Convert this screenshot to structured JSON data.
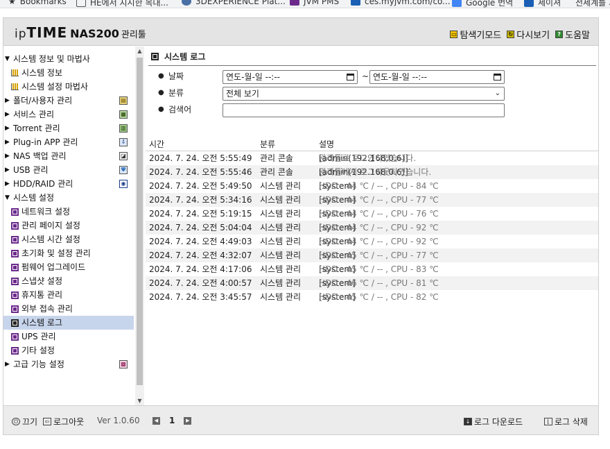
{
  "bookmarks": [
    {
      "label": "Bookmarks",
      "color": "#333333"
    },
    {
      "label": "HE에서 지시한 목대...",
      "color": "#555555"
    },
    {
      "label": "3DEXPERIENCE Plat...",
      "color": "#4a6fa5"
    },
    {
      "label": "JVM PMS",
      "color": "#6b2a8b"
    },
    {
      "label": "ces.myjvm.com/co...",
      "color": "#1a5fb4"
    },
    {
      "label": "Google 번역",
      "color": "#4285f4"
    },
    {
      "label": "세이셔",
      "color": "#1a5fb4"
    },
    {
      "label": "전세계를 가...",
      "color": "#777777"
    }
  ],
  "header": {
    "logo_ip": "ip",
    "logo_time": "TIME",
    "logo_model": "NAS200",
    "logo_suffix": "관리툴",
    "links": {
      "navigator": "탐색기모드",
      "reload": "다시보기",
      "help": "도움말"
    }
  },
  "sidebar": {
    "system_info": "시스템 정보 및 마법사",
    "system_info_item": "시스템 정보",
    "wizard": "시스템 설정 마법사",
    "folder_user": "폴더/사용자 관리",
    "service": "서비스 관리",
    "torrent": "Torrent 관리",
    "plugin": "Plug-in APP 관리",
    "nas_backup": "NAS 백업 관리",
    "usb": "USB 관리",
    "hdd_raid": "HDD/RAID 관리",
    "system_settings": "시스템 설정",
    "network": "네트워크 설정",
    "admin_page": "관리 페이지 설정",
    "system_time": "시스템 시간 설정",
    "reset": "초기화 및 설정 관리",
    "firmware": "펌웨어 업그레이드",
    "snapshot": "스냅샷 설정",
    "trash": "휴지통 관리",
    "remote_access": "외부 접속 관리",
    "system_log": "시스템 로그",
    "ups": "UPS 관리",
    "other": "기타 설정",
    "advanced": "고급 기능 설정"
  },
  "main": {
    "title": "시스템 로그",
    "filters": {
      "date_label": "날짜",
      "date_from": "연도-월-일  --:--",
      "date_sep": "~",
      "date_to": "연도-월-일  --:--",
      "category_label": "분류",
      "category_value": "전체 보기",
      "search_label": "검색어",
      "search_value": ""
    },
    "columns": {
      "time": "시간",
      "category": "분류",
      "description": "설명"
    },
    "rows": [
      {
        "time": "2024. 7. 24. 오전 5:55:49",
        "category": "관리 콘솔",
        "tag": "[admin(192.168.0.6)]",
        "message": " 관리툴로 로그인하였습니다."
      },
      {
        "time": "2024. 7. 24. 오전 5:55:46",
        "category": "관리 콘솔",
        "tag": "[admin(192.168.0.6)]",
        "message": " 관리툴에서 로그아웃하였습니다."
      },
      {
        "time": "2024. 7. 24. 오전 5:49:50",
        "category": "시스템 관리",
        "tag": "[system]",
        "message": " HDD - 44 ℃ / -- , CPU - 84 ℃"
      },
      {
        "time": "2024. 7. 24. 오전 5:34:16",
        "category": "시스템 관리",
        "tag": "[system]",
        "message": " HDD - 44 ℃ / -- , CPU - 77 ℃"
      },
      {
        "time": "2024. 7. 24. 오전 5:19:15",
        "category": "시스템 관리",
        "tag": "[system]",
        "message": " HDD - 44 ℃ / -- , CPU - 76 ℃"
      },
      {
        "time": "2024. 7. 24. 오전 5:04:04",
        "category": "시스템 관리",
        "tag": "[system]",
        "message": " HDD - 44 ℃ / -- , CPU - 92 ℃"
      },
      {
        "time": "2024. 7. 24. 오전 4:49:03",
        "category": "시스템 관리",
        "tag": "[system]",
        "message": " HDD - 44 ℃ / -- , CPU - 92 ℃"
      },
      {
        "time": "2024. 7. 24. 오전 4:32:07",
        "category": "시스템 관리",
        "tag": "[system]",
        "message": " HDD - 45 ℃ / -- , CPU - 77 ℃"
      },
      {
        "time": "2024. 7. 24. 오전 4:17:06",
        "category": "시스템 관리",
        "tag": "[system]",
        "message": " HDD - 45 ℃ / -- , CPU - 83 ℃"
      },
      {
        "time": "2024. 7. 24. 오전 4:00:57",
        "category": "시스템 관리",
        "tag": "[system]",
        "message": " HDD - 46 ℃ / -- , CPU - 81 ℃"
      },
      {
        "time": "2024. 7. 24. 오전 3:45:57",
        "category": "시스템 관리",
        "tag": "[system]",
        "message": " HDD - 45 ℃ / -- , CPU - 82 ℃"
      }
    ]
  },
  "footer": {
    "power": "끄기",
    "logout": "로그아웃",
    "version": "Ver 1.0.60",
    "page": "1",
    "download": "로그 다운로드",
    "delete": "로그 삭제"
  },
  "colors": {
    "selected_row": "#c7d5ec",
    "header_bg": "#e4e4e4",
    "footer_bg": "#ececec"
  }
}
